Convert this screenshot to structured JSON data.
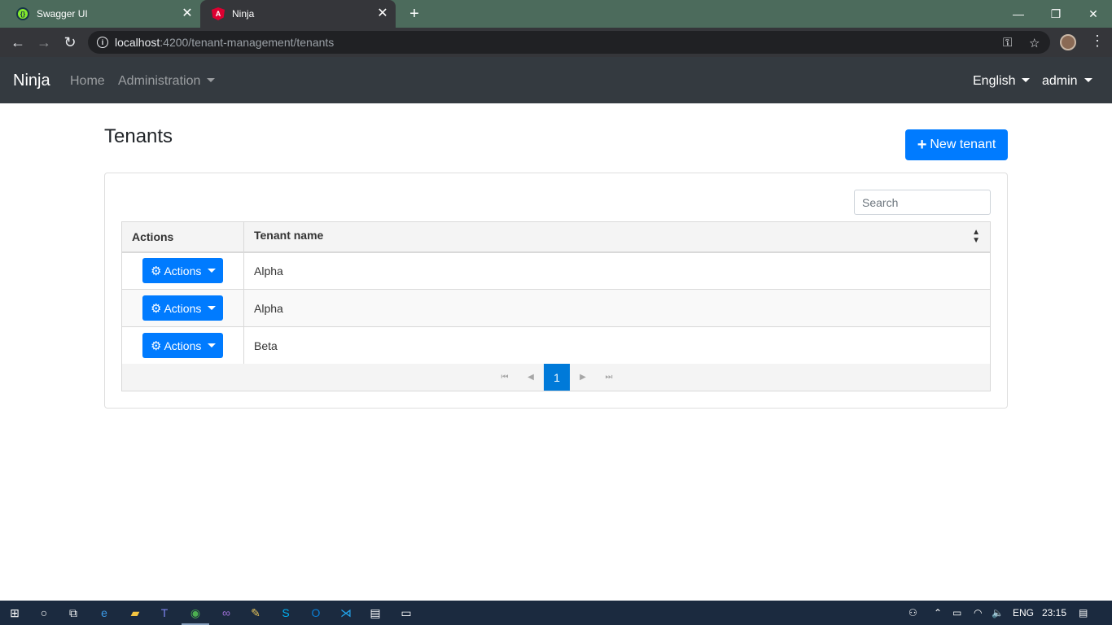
{
  "browser": {
    "tabs": [
      {
        "title": "Swagger UI",
        "favicon": "swagger-icon",
        "close": "✕"
      },
      {
        "title": "Ninja",
        "favicon": "angular-icon",
        "close": "✕"
      }
    ],
    "new_tab": "+",
    "controls": {
      "minimize": "—",
      "restore": "❐",
      "close": "✕"
    },
    "url_host": "localhost",
    "url_rest": ":4200/tenant-management/tenants"
  },
  "navbar": {
    "brand": "Ninja",
    "home": "Home",
    "administration": "Administration",
    "language": "English",
    "user": "admin"
  },
  "page": {
    "title": "Tenants",
    "new_tenant": "New tenant"
  },
  "search": {
    "placeholder": "Search"
  },
  "table": {
    "headers": {
      "actions": "Actions",
      "tenant_name": "Tenant name"
    },
    "action_label": "Actions",
    "rows": [
      {
        "name": "Alpha"
      },
      {
        "name": "Alpha"
      },
      {
        "name": "Beta"
      }
    ]
  },
  "paginator": {
    "current_page": "1"
  },
  "taskbar": {
    "lang": "ENG",
    "time": "23:15"
  },
  "colors": {
    "primary": "#007bff",
    "navbar": "#343a40",
    "tabstrip": "#4c6b5c",
    "page_active": "#007ad9"
  }
}
